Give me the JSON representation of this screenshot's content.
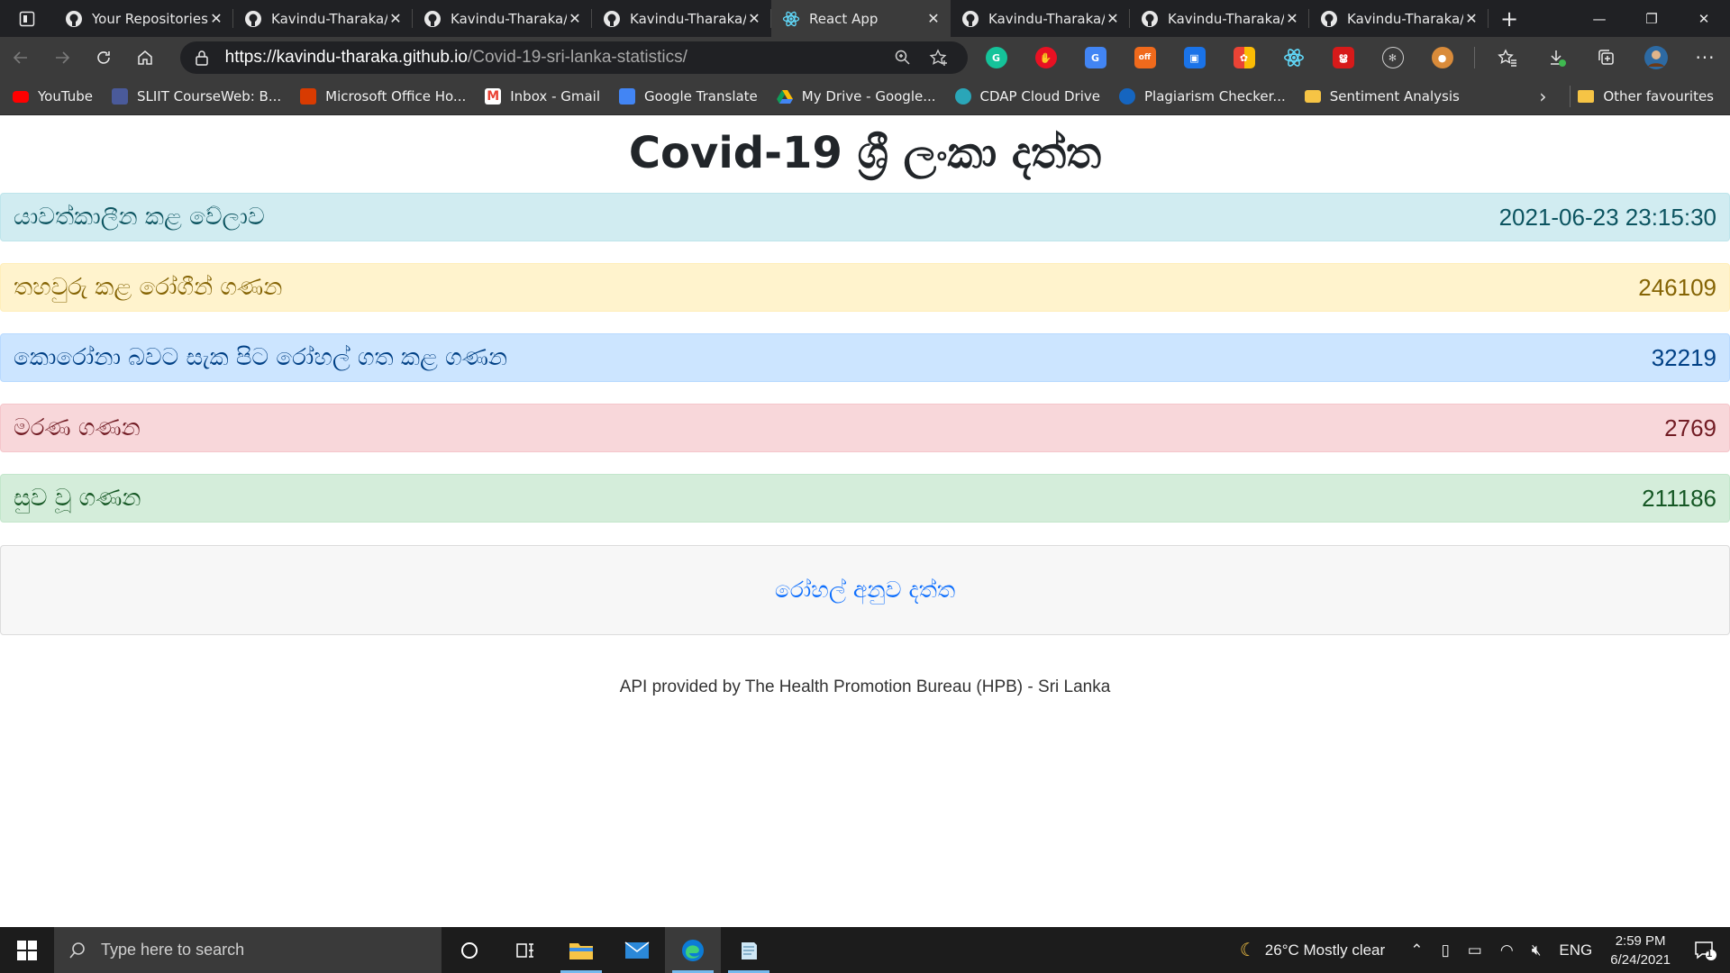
{
  "browser": {
    "tabs": [
      {
        "title": "Your Repositories",
        "favicon": "github-icon",
        "active": false
      },
      {
        "title": "Kavindu-Tharaka/",
        "favicon": "github-icon",
        "active": false
      },
      {
        "title": "Kavindu-Tharaka/",
        "favicon": "github-icon",
        "active": false
      },
      {
        "title": "Kavindu-Tharaka/",
        "favicon": "github-icon",
        "active": false
      },
      {
        "title": "React App",
        "favicon": "react-icon",
        "active": true
      },
      {
        "title": "Kavindu-Tharaka/",
        "favicon": "github-icon",
        "active": false
      },
      {
        "title": "Kavindu-Tharaka/",
        "favicon": "github-icon",
        "active": false
      },
      {
        "title": "Kavindu-Tharaka/",
        "favicon": "github-icon",
        "active": false
      }
    ],
    "url_host": "https://kavindu-tharaka.github.io",
    "url_path": "/Covid-19-sri-lanka-statistics/",
    "bookmarks": [
      {
        "label": "YouTube",
        "icon": "youtube-icon",
        "color": "#ff0000"
      },
      {
        "label": "SLIIT CourseWeb: B...",
        "icon": "sliit-icon",
        "color": "#4a5a9a"
      },
      {
        "label": "Microsoft Office Ho...",
        "icon": "office-icon",
        "color": "#d83b01"
      },
      {
        "label": "Inbox - Gmail",
        "icon": "gmail-icon",
        "color": "#ea4335"
      },
      {
        "label": "Google Translate",
        "icon": "translate-icon",
        "color": "#4285f4"
      },
      {
        "label": "My Drive - Google...",
        "icon": "drive-icon",
        "color": "#0f9d58"
      },
      {
        "label": "CDAP Cloud Drive",
        "icon": "cloud-icon",
        "color": "#2aa6b8"
      },
      {
        "label": "Plagiarism Checker...",
        "icon": "plagiarism-icon",
        "color": "#1565c0"
      },
      {
        "label": "Sentiment Analysis",
        "icon": "folder-icon",
        "color": "#f6c445"
      }
    ],
    "other_favourites": "Other favourites"
  },
  "page": {
    "title": "Covid-19 ශ්‍රී ලංකා දත්ත",
    "stats": {
      "updated": {
        "label": "යාවත්කාලීන කළ වේලාව",
        "value": "2021-06-23 23:15:30"
      },
      "confirmed": {
        "label": "තහවුරු කළ රෝගීන් ගණන",
        "value": "246109"
      },
      "hospitalized": {
        "label": "කොරෝනා බවට සැක පිට රෝහල් ගත කළ ගණන",
        "value": "32219"
      },
      "deaths": {
        "label": "මරණ ගණන",
        "value": "2769"
      },
      "recovered": {
        "label": "සුව වූ ගණන",
        "value": "211186"
      }
    },
    "hospital_link": "රෝහල් අනුව දත්ත",
    "footer": "API provided by The Health Promotion Bureau (HPB) - Sri Lanka"
  },
  "taskbar": {
    "search_placeholder": "Type here to search",
    "weather": "26°C  Mostly clear",
    "language": "ENG",
    "time": "2:59 PM",
    "date": "6/24/2021",
    "notification_count": "1"
  }
}
